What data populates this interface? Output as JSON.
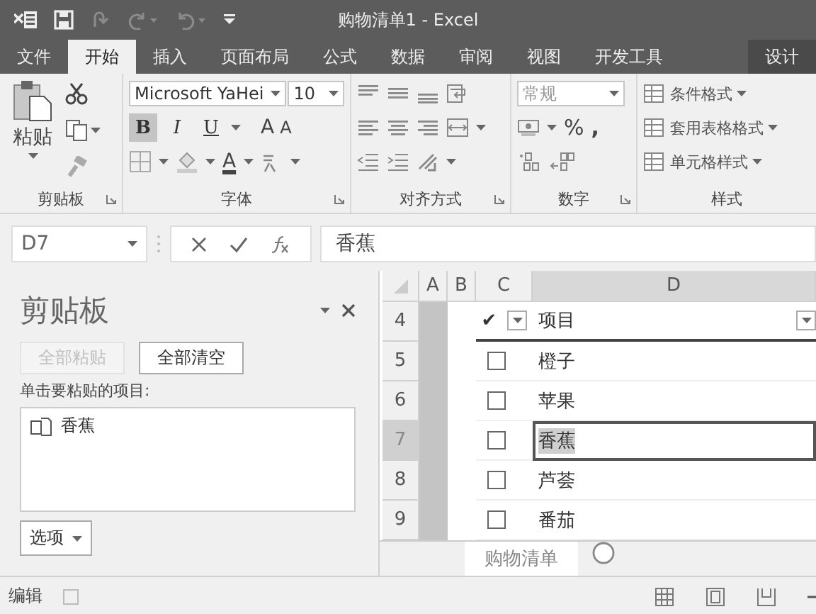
{
  "window": {
    "title": "购物清单1 - Excel"
  },
  "ribbon_tabs": [
    {
      "label": "文件",
      "selected": false,
      "kind": "normal"
    },
    {
      "label": "开始",
      "selected": true,
      "kind": "normal"
    },
    {
      "label": "插入",
      "selected": false,
      "kind": "normal"
    },
    {
      "label": "页面布局",
      "selected": false,
      "kind": "normal"
    },
    {
      "label": "公式",
      "selected": false,
      "kind": "normal"
    },
    {
      "label": "数据",
      "selected": false,
      "kind": "normal"
    },
    {
      "label": "审阅",
      "selected": false,
      "kind": "normal"
    },
    {
      "label": "视图",
      "selected": false,
      "kind": "normal"
    },
    {
      "label": "开发工具",
      "selected": false,
      "kind": "normal"
    },
    {
      "label": "设计",
      "selected": false,
      "kind": "contextual"
    }
  ],
  "ribbon": {
    "clipboard": {
      "paste": "粘贴",
      "label": "剪贴板"
    },
    "font": {
      "font_name": "Microsoft YaHei",
      "font_size": "10",
      "style_buttons": [
        {
          "label": "B",
          "pressed": true
        },
        {
          "label": "I",
          "pressed": false
        },
        {
          "label": "U",
          "pressed": false
        }
      ],
      "grow": "A",
      "shrink": "A",
      "font_color": "A",
      "label": "字体"
    },
    "alignment": {
      "label": "对齐方式"
    },
    "number": {
      "format": "常规",
      "percent": "%",
      "comma": ",",
      "label": "数字"
    },
    "styles": {
      "items": [
        "条件格式",
        "套用表格格式",
        "单元格样式"
      ],
      "label": "样式"
    }
  },
  "formula_bar": {
    "name_box": "D7",
    "value": "香蕉"
  },
  "clipboard_pane": {
    "title": "剪贴板",
    "buttons": [
      {
        "label": "全部粘贴",
        "disabled": true
      },
      {
        "label": "全部清空",
        "disabled": false
      }
    ],
    "instruction": "单击要粘贴的项目:",
    "items": [
      "香蕉"
    ],
    "options": "选项"
  },
  "sheet": {
    "columns": [
      {
        "label": "A",
        "selected": false
      },
      {
        "label": "B",
        "selected": false
      },
      {
        "label": "C",
        "selected": false
      },
      {
        "label": "D",
        "selected": true
      }
    ],
    "header_row": {
      "row": "4",
      "check": "✔",
      "label": "项目"
    },
    "rows": [
      {
        "row": "5",
        "item": "橙子",
        "checked": false,
        "selected": false
      },
      {
        "row": "6",
        "item": "苹果",
        "checked": false,
        "selected": false
      },
      {
        "row": "7",
        "item": "香蕉",
        "checked": false,
        "selected": true
      },
      {
        "row": "8",
        "item": "芦荟",
        "checked": false,
        "selected": false
      },
      {
        "row": "9",
        "item": "番茄",
        "checked": false,
        "selected": false
      }
    ],
    "sheet_tabs": [
      {
        "label": "购物清单",
        "selected": true
      }
    ]
  },
  "status_bar": {
    "mode": "编辑"
  }
}
